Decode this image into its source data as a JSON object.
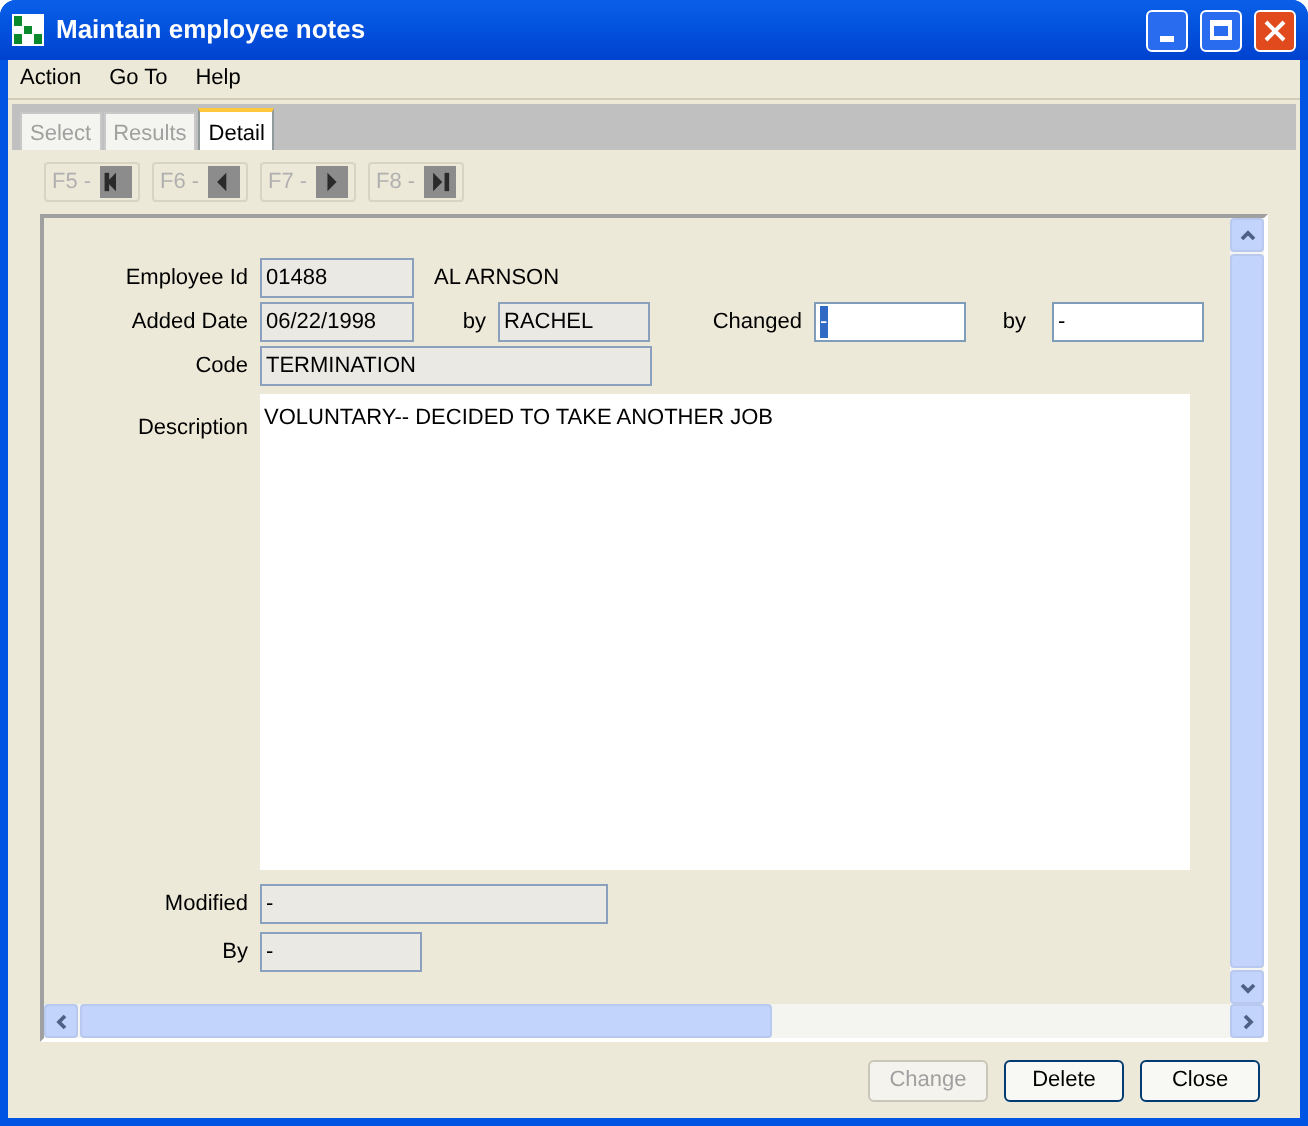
{
  "window": {
    "title": "Maintain employee notes"
  },
  "menu": [
    {
      "label": "Action"
    },
    {
      "label": "Go To"
    },
    {
      "label": "Help"
    }
  ],
  "tabs": [
    {
      "label": "Select",
      "selected": false
    },
    {
      "label": "Results",
      "selected": false
    },
    {
      "label": "Detail",
      "selected": true
    }
  ],
  "nav_buttons": [
    {
      "key": "F5 -",
      "kind": "first",
      "disabled": true
    },
    {
      "key": "F6 -",
      "kind": "previous",
      "disabled": true
    },
    {
      "key": "F7 -",
      "kind": "next",
      "disabled": true
    },
    {
      "key": "F8 -",
      "kind": "last",
      "disabled": true
    }
  ],
  "form": {
    "employee_id": {
      "label": "Employee Id",
      "value": "01488",
      "editable": false
    },
    "employee_name": "AL ARNSON",
    "added_date": {
      "label": "Added Date",
      "value": "06/22/1998",
      "editable": false
    },
    "added_by": {
      "label": "by",
      "value": "RACHEL",
      "editable": false
    },
    "changed": {
      "label": "Changed",
      "value": "-",
      "editable": true,
      "highlighted": true
    },
    "changed_by": {
      "label": "by",
      "value": "-",
      "editable": true,
      "highlighted": false
    },
    "code": {
      "label": "Code",
      "value": "TERMINATION",
      "editable": false
    },
    "description": {
      "label": "Description",
      "value": "VOLUNTARY-- DECIDED TO TAKE ANOTHER JOB"
    },
    "modified": {
      "label": "Modified",
      "value": "-",
      "editable": false
    },
    "by": {
      "label": "By",
      "value": "-",
      "editable": false
    }
  },
  "buttons": [
    {
      "label": "Change",
      "disabled": true
    },
    {
      "label": "Delete",
      "disabled": false
    },
    {
      "label": "Close",
      "disabled": false
    }
  ]
}
